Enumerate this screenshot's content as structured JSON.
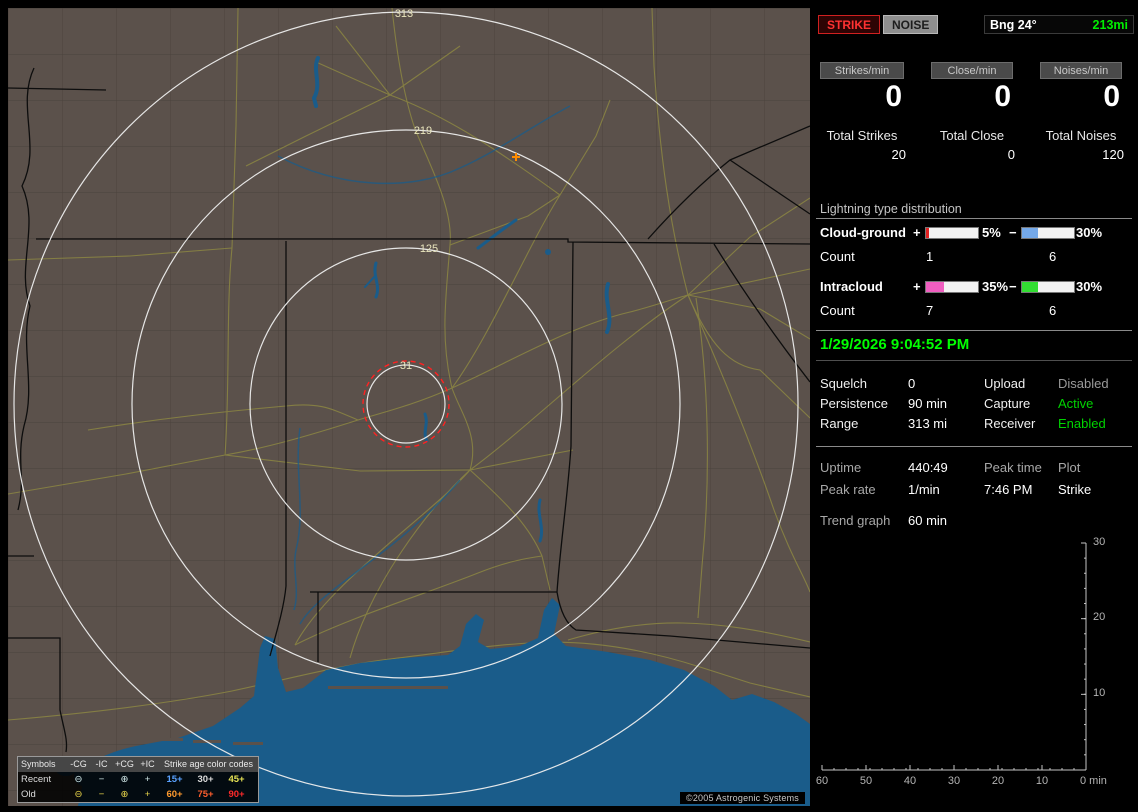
{
  "map": {
    "range_labels": [
      "313",
      "219",
      "125",
      "31"
    ],
    "copyright": "©2005 Astrogenic Systems",
    "legend": {
      "header_symbols": "Symbols",
      "columns": [
        "-CG",
        "-IC",
        "+CG",
        "+IC"
      ],
      "header_ages": "Strike age color codes",
      "rows": [
        {
          "label": "Recent",
          "symbols": [
            "⊖",
            "−",
            "⊕",
            "+"
          ],
          "symbol_color": "#d2e8e8",
          "ages": [
            {
              "text": "15+",
              "color": "#5aa2ff"
            },
            {
              "text": "30+",
              "color": "#dcdcdc"
            },
            {
              "text": "45+",
              "color": "#e8e455"
            }
          ]
        },
        {
          "label": "Old",
          "symbols": [
            "⊖",
            "−",
            "⊕",
            "+"
          ],
          "symbol_color": "#e8d44a",
          "ages": [
            {
              "text": "60+",
              "color": "#ff9a2e"
            },
            {
              "text": "75+",
              "color": "#ff5f2e"
            },
            {
              "text": "90+",
              "color": "#ff2a2a"
            }
          ]
        }
      ]
    }
  },
  "panel": {
    "strike_button": "STRIKE",
    "noise_button": "NOISE",
    "bearing_label": "Bng 24°",
    "bearing_range": "213mi",
    "rates": [
      {
        "label": "Strikes/min",
        "value": "0"
      },
      {
        "label": "Close/min",
        "value": "0"
      },
      {
        "label": "Noises/min",
        "value": "0"
      }
    ],
    "totals": [
      {
        "label": "Total Strikes",
        "value": "20"
      },
      {
        "label": "Total Close",
        "value": "0"
      },
      {
        "label": "Total Noises",
        "value": "120"
      }
    ],
    "distribution": {
      "title": "Lightning type distribution",
      "plus_sign": "+",
      "minus_sign": "−",
      "rows": [
        {
          "label": "Cloud-ground",
          "plus": {
            "pct": 5,
            "color": "#e02020",
            "text": "5%"
          },
          "minus": {
            "pct": 30,
            "color": "#74a8e8",
            "text": "30%"
          },
          "count_label": "Count",
          "plus_count": "1",
          "minus_count": "6"
        },
        {
          "label": "Intracloud",
          "plus": {
            "pct": 35,
            "color": "#f05ec0",
            "text": "35%"
          },
          "minus": {
            "pct": 30,
            "color": "#32dd32",
            "text": "30%"
          },
          "count_label": "Count",
          "plus_count": "7",
          "minus_count": "6"
        }
      ]
    },
    "datetime": "1/29/2026 9:04:52 PM",
    "status_left": [
      {
        "label": "Squelch",
        "value": "0"
      },
      {
        "label": "Persistence",
        "value": "90 min"
      },
      {
        "label": "Range",
        "value": "313 mi"
      }
    ],
    "status_right": [
      {
        "label": "Upload",
        "value": "Disabled",
        "color": "#9a9a9a"
      },
      {
        "label": "Capture",
        "value": "Active",
        "color": "#00d400"
      },
      {
        "label": "Receiver",
        "value": "Enabled",
        "color": "#00d400"
      }
    ],
    "stats": {
      "uptime_label": "Uptime",
      "uptime_value": "440:49",
      "peak_rate_label": "Peak rate",
      "peak_rate_value": "1/min",
      "peak_time_label": "Peak time",
      "peak_time_value": "7:46 PM",
      "plot_label": "Plot",
      "plot_value": "Strike",
      "trend_label": "Trend graph",
      "trend_value": "60 min"
    },
    "graph": {
      "y_ticks": [
        "30",
        "20",
        "10"
      ],
      "x_ticks": [
        "60",
        "50",
        "40",
        "30",
        "20",
        "10"
      ],
      "x_last": "0 min"
    }
  }
}
